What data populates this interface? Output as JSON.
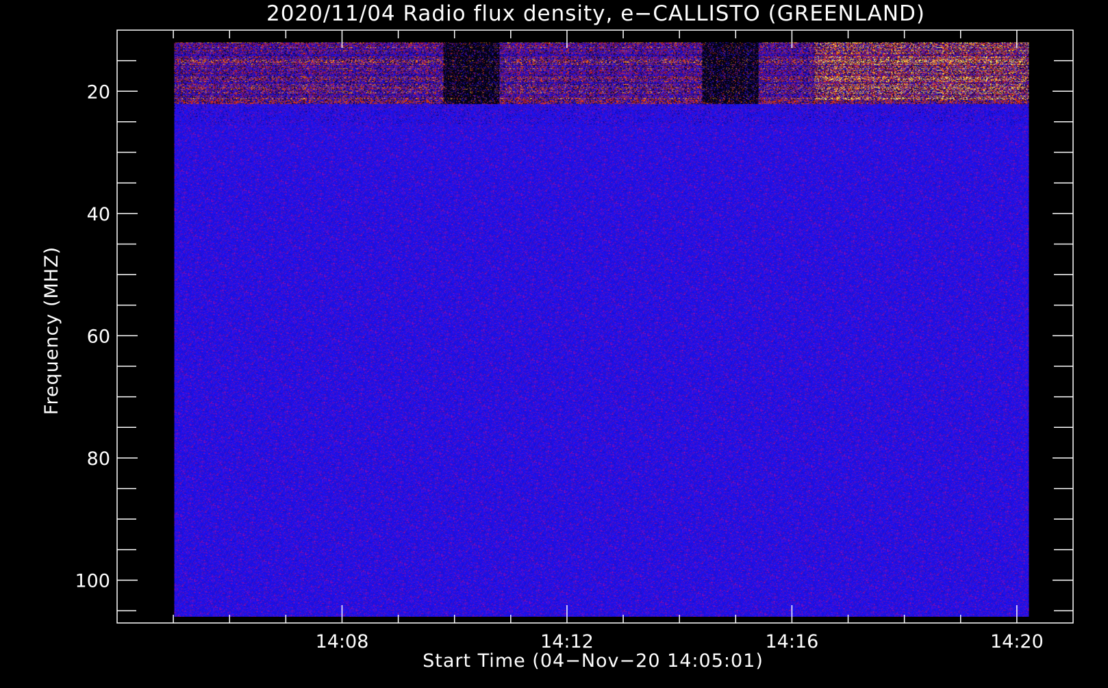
{
  "chart_data": {
    "type": "heatmap",
    "title": "2020/11/04  Radio flux density, e−CALLISTO (GREENLAND)",
    "xlabel": "Start Time (04−Nov−20 14:05:01)",
    "ylabel": "Frequency (MHZ)",
    "x_unit": "time (HH:MM, 04-Nov-2020)",
    "y_unit": "MHz",
    "xlim": [
      "14:04",
      "14:21"
    ],
    "ylim": [
      10,
      107
    ],
    "y_inverted": true,
    "data_time_range": [
      "14:05:01",
      "14:20:13"
    ],
    "data_freq_range": [
      12,
      106
    ],
    "x_ticks": [
      {
        "value": "14:08",
        "label": "14:08"
      },
      {
        "value": "14:12",
        "label": "14:12"
      },
      {
        "value": "14:16",
        "label": "14:16"
      },
      {
        "value": "14:20",
        "label": "14:20"
      }
    ],
    "x_minor_step_minutes": 1,
    "y_ticks": [
      {
        "value": 20,
        "label": "20"
      },
      {
        "value": 40,
        "label": "40"
      },
      {
        "value": 60,
        "label": "60"
      },
      {
        "value": 80,
        "label": "80"
      },
      {
        "value": 100,
        "label": "100"
      }
    ],
    "y_minor_step_mhz": 5,
    "colors": {
      "background": "#000000",
      "axes": "#ffffff",
      "low_flux": "#1a10e6",
      "mid_flux": "#c01808",
      "high_flux": "#ff9a10",
      "peak_flux": "#ffff70"
    },
    "bursts": {
      "active_band_mhz": [
        12,
        22
      ],
      "quiet_band_mhz": [
        22,
        106
      ],
      "dark_gaps_time": [
        [
          "14:09:48",
          "14:10:48"
        ],
        [
          "14:14:24",
          "14:14:48"
        ],
        [
          "14:14:48",
          "14:15:24"
        ]
      ],
      "bright_interval_time": [
        "14:16:24",
        "14:20:13"
      ]
    }
  }
}
